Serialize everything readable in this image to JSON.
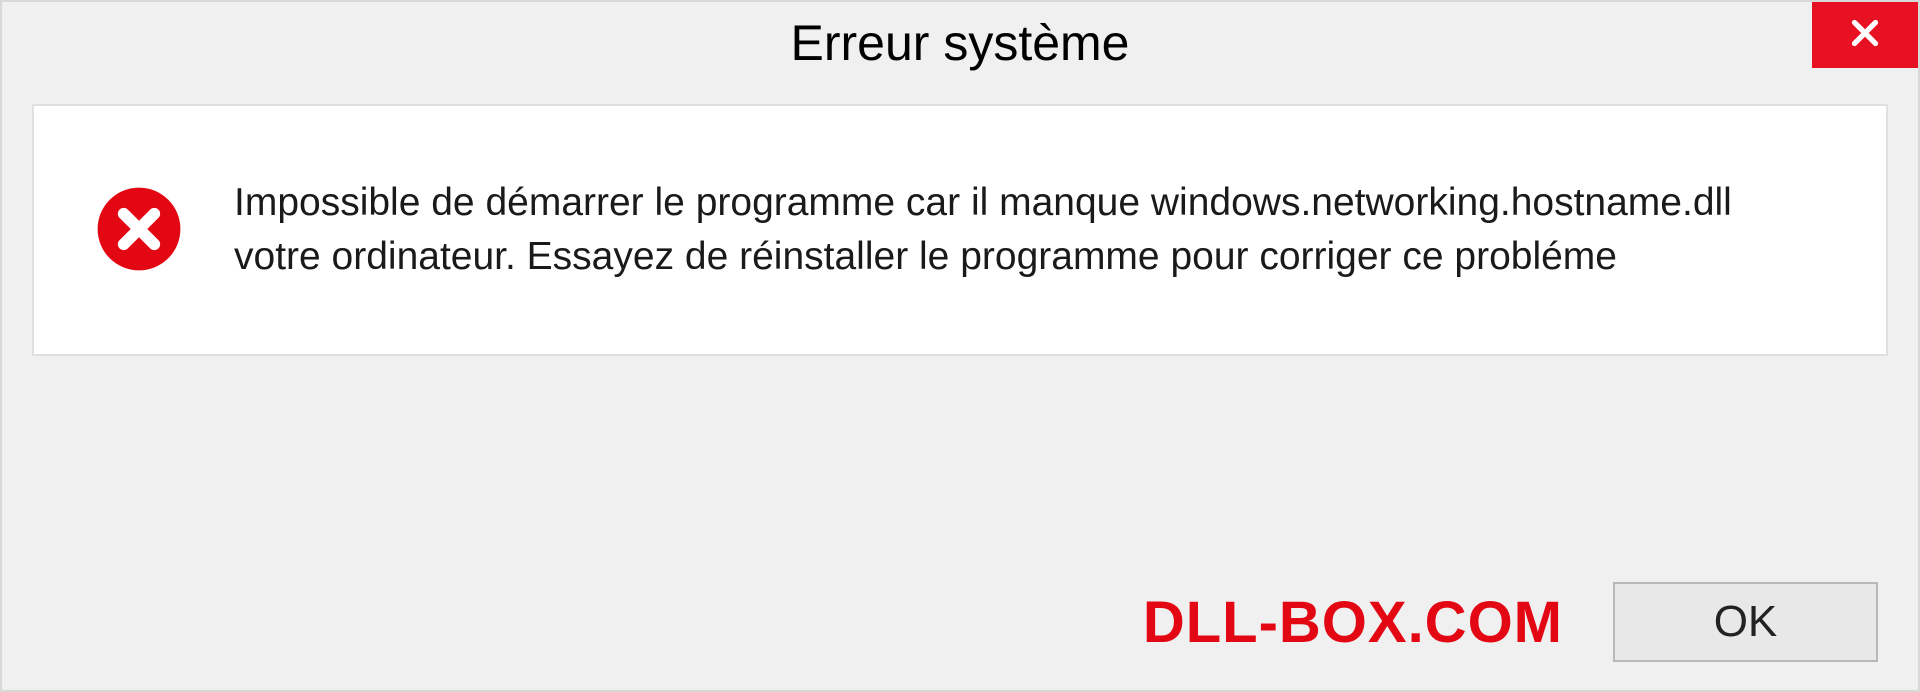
{
  "dialog": {
    "title": "Erreur système",
    "message": "Impossible de démarrer le programme car il manque windows.networking.hostname.dll votre ordinateur. Essayez de réinstaller le programme pour corriger ce probléme",
    "ok_label": "OK"
  },
  "watermark": "DLL-BOX.COM",
  "colors": {
    "close_bg": "#e81123",
    "error_red": "#e30613",
    "panel_bg": "#f0f0f0"
  }
}
